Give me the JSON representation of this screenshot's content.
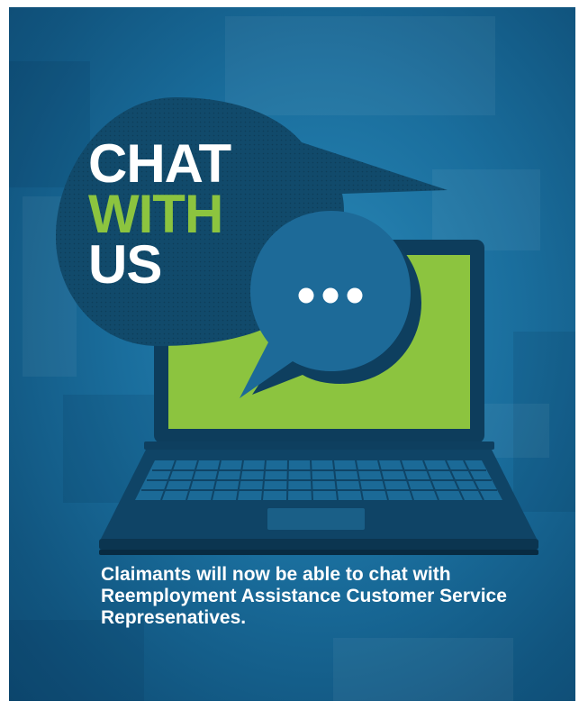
{
  "headline": {
    "line1": "CHAT",
    "line2": "WITH",
    "line3": "US"
  },
  "caption": "Claimants will now be able to chat with Reemployment Assistance Customer Service Represenatives.",
  "colors": {
    "background": "#1a6e9d",
    "bubble_dark": "#114a6b",
    "bubble_light": "#1d6a98",
    "screen_green": "#8cc43f",
    "headline_white": "#ffffff",
    "headline_green": "#8cc43f"
  },
  "icons": [
    "chat-bubble-icon",
    "typing-dots-icon",
    "laptop-icon"
  ]
}
